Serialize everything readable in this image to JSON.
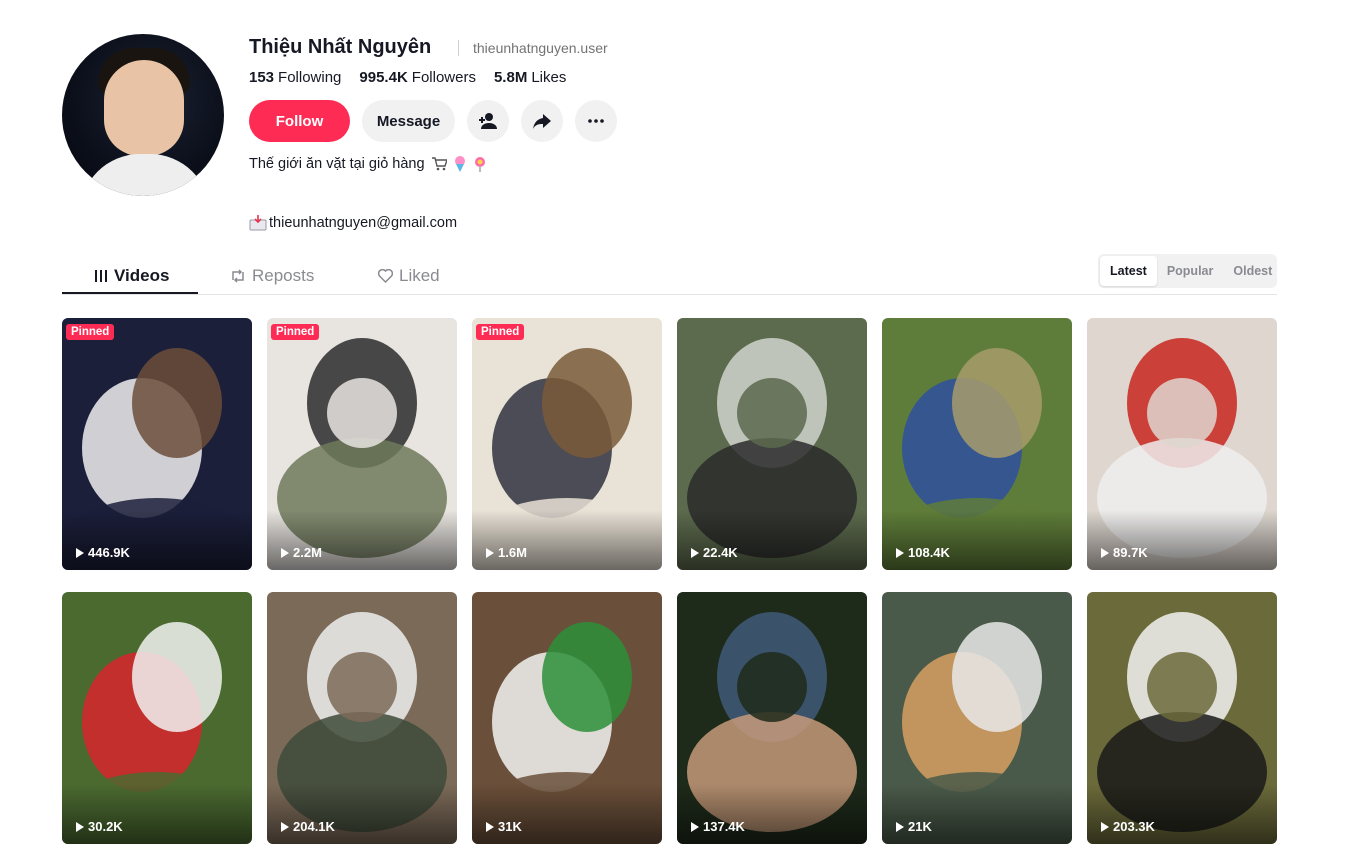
{
  "profile": {
    "name": "Thiệu Nhất Nguyên",
    "username": "thieunhatnguyen.user",
    "stats": [
      {
        "value": "153",
        "label": "Following"
      },
      {
        "value": "995.4K",
        "label": "Followers"
      },
      {
        "value": "5.8M",
        "label": "Likes"
      }
    ],
    "follow_label": "Follow",
    "message_label": "Message",
    "bio": "Thế giới ăn vặt tại giỏ hàng",
    "email": "thieunhatnguyen@gmail.com",
    "icons": [
      "add-friend-icon",
      "share-icon",
      "more-icon",
      "cart-icon",
      "ice-cream-icon",
      "lollipop-icon",
      "inbox-icon"
    ]
  },
  "tabs": [
    {
      "label": "Videos",
      "icon": "grid-icon"
    },
    {
      "label": "Reposts",
      "icon": "repost-icon"
    },
    {
      "label": "Liked",
      "icon": "heart-icon"
    }
  ],
  "sort": [
    "Latest",
    "Popular",
    "Oldest"
  ],
  "pinned_label": "Pinned",
  "videos": [
    {
      "views": "446.9K",
      "pinned": true,
      "colors": [
        "#1b1f3a",
        "#f0f0f0",
        "#6b4e3a"
      ]
    },
    {
      "views": "2.2M",
      "pinned": true,
      "colors": [
        "#e8e4e0",
        "#2b2b2b",
        "#6f7a5a"
      ]
    },
    {
      "views": "1.6M",
      "pinned": true,
      "colors": [
        "#e9e2d6",
        "#2f3140",
        "#7a5a3a"
      ]
    },
    {
      "views": "22.4K",
      "pinned": false,
      "colors": [
        "#5c6a4d",
        "#cfd3cc",
        "#2a2a2a"
      ]
    },
    {
      "views": "108.4K",
      "pinned": false,
      "colors": [
        "#5f7d3a",
        "#2f4fa0",
        "#a79b6b"
      ]
    },
    {
      "views": "89.7K",
      "pinned": false,
      "colors": [
        "#ded6cf",
        "#c8261f",
        "#eeeeee"
      ]
    },
    {
      "views": "30.2K",
      "pinned": false,
      "colors": [
        "#4b6a30",
        "#d8252b",
        "#f2f2f2"
      ]
    },
    {
      "views": "204.1K",
      "pinned": false,
      "colors": [
        "#7c6a58",
        "#efefef",
        "#3e4a3a"
      ]
    },
    {
      "views": "31K",
      "pinned": false,
      "colors": [
        "#6a4f3a",
        "#f2f2f2",
        "#2b8f3a"
      ]
    },
    {
      "views": "137.4K",
      "pinned": false,
      "colors": [
        "#1e2a1a",
        "#3f5a7a",
        "#c79a7a"
      ]
    },
    {
      "views": "21K",
      "pinned": false,
      "colors": [
        "#4a5a4a",
        "#d6a060",
        "#e9e9e9"
      ]
    },
    {
      "views": "203.3K",
      "pinned": false,
      "colors": [
        "#6b6a3a",
        "#f2f2f2",
        "#1a1a1a"
      ]
    }
  ]
}
